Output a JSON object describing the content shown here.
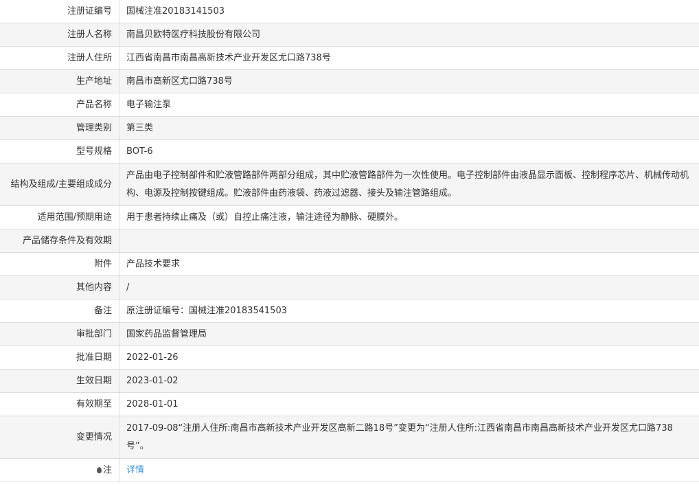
{
  "rows": [
    {
      "label": "注册证编号",
      "value": "国械注准20183141503"
    },
    {
      "label": "注册人名称",
      "value": "南昌贝欧特医疗科技股份有限公司"
    },
    {
      "label": "注册人住所",
      "value": "江西省南昌市南昌高新技术产业开发区尤口路738号"
    },
    {
      "label": "生产地址",
      "value": "南昌市高新区尤口路738号"
    },
    {
      "label": "产品名称",
      "value": "电子输注泵"
    },
    {
      "label": "管理类别",
      "value": "第三类"
    },
    {
      "label": "型号规格",
      "value": "BOT-6"
    },
    {
      "label": "结构及组成/主要组成成分",
      "value": "产品由电子控制部件和贮液管路部件两部分组成，其中贮液管路部件为一次性使用。电子控制部件由液晶显示面板、控制程序芯片、机械传动机构、电源及控制按键组成。贮液部件由药液袋、药液过滤器、接头及输注管路组成。"
    },
    {
      "label": "适用范围/预期用途",
      "value": "用于患者持续止痛及（或）自控止痛注液，输注途径为静脉、硬膜外。"
    },
    {
      "label": "产品储存条件及有效期",
      "value": ""
    },
    {
      "label": "附件",
      "value": "产品技术要求"
    },
    {
      "label": "其他内容",
      "value": "/"
    },
    {
      "label": "备注",
      "value": "原注册证编号：国械注准20183541503"
    },
    {
      "label": "审批部门",
      "value": "国家药品监督管理局"
    },
    {
      "label": "批准日期",
      "value": "2022-01-26"
    },
    {
      "label": "生效日期",
      "value": "2023-01-02"
    },
    {
      "label": "有效期至",
      "value": "2028-01-01"
    },
    {
      "label": "变更情况",
      "value": "2017-09-08“注册人住所:南昌市高新技术产业开发区高新二路18号”变更为“注册人住所:江西省南昌市南昌高新技术产业开发区尤口路738号”。"
    }
  ],
  "note": {
    "label": "注",
    "link": "详情",
    "icon": "pin-icon"
  }
}
